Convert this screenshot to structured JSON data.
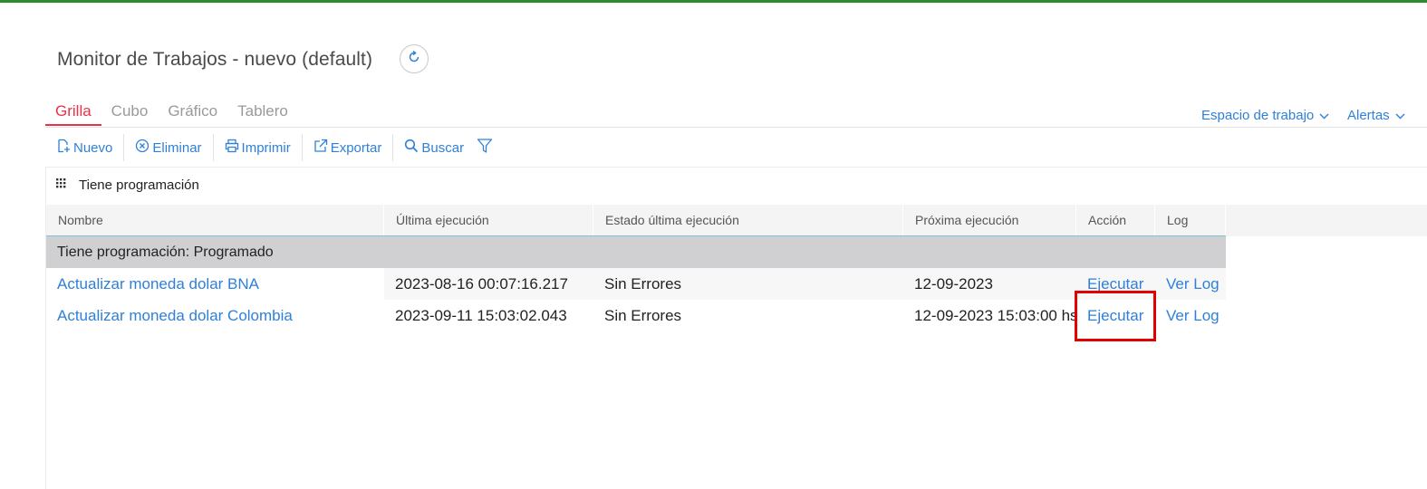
{
  "page": {
    "title": "Monitor de Trabajos - nuevo (default)"
  },
  "tabs": [
    {
      "label": "Grilla",
      "active": true
    },
    {
      "label": "Cubo",
      "active": false
    },
    {
      "label": "Gráfico",
      "active": false
    },
    {
      "label": "Tablero",
      "active": false
    }
  ],
  "menus": {
    "workspace": "Espacio de trabajo",
    "alerts": "Alertas"
  },
  "toolbar": {
    "new": "Nuevo",
    "delete": "Eliminar",
    "print": "Imprimir",
    "export": "Exportar",
    "search": "Buscar"
  },
  "grouping": {
    "label": "Tiene programación"
  },
  "grid": {
    "columns": [
      "Nombre",
      "Última ejecución",
      "Estado última ejecución",
      "Próxima ejecución",
      "Acción",
      "Log"
    ],
    "group_header": "Tiene programación: Programado",
    "rows": [
      {
        "name": "Actualizar moneda dolar BNA",
        "last_run": "2023-08-16 00:07:16.217",
        "status": "Sin Errores",
        "next_run": "12-09-2023",
        "action": "Ejecutar",
        "log": "Ver Log"
      },
      {
        "name": "Actualizar moneda dolar Colombia",
        "last_run": "2023-09-11 15:03:02.043",
        "status": "Sin Errores",
        "next_run": "12-09-2023 15:03:00 hs",
        "action": "Ejecutar",
        "log": "Ver Log"
      }
    ]
  },
  "colors": {
    "accent": "#2f80d8",
    "active_tab": "#e8314a",
    "top_bar": "#2e8b2e",
    "highlight": "#e30000"
  }
}
